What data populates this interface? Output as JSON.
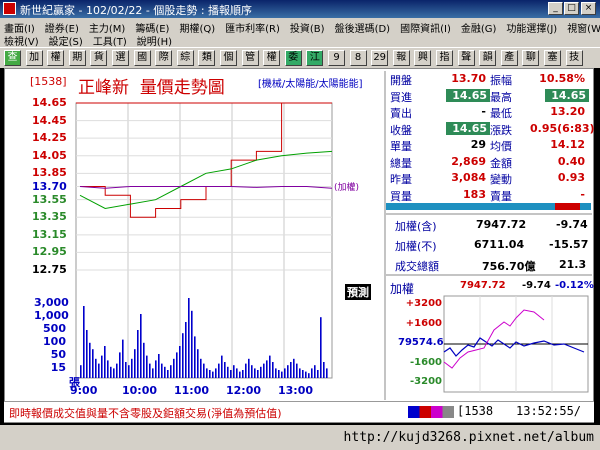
{
  "window": {
    "title": "新世紀贏家 - 102/02/22 - 個股走勢 : 播報順序",
    "min": "_",
    "restore": "□",
    "close": "×"
  },
  "menu": {
    "row1": [
      "畫面(I)",
      "證券(E)",
      "主力(M)",
      "籌碼(E)",
      "期權(Q)",
      "匯市利率(R)",
      "投資(B)",
      "盤後選碼(D)",
      "國際資訊(I)",
      "金融(G)",
      "功能選擇(J)",
      "視窗(W)"
    ],
    "row2": [
      "檢視(V)",
      "設定(S)",
      "工具(T)",
      "說明(H)"
    ]
  },
  "toolbar": [
    "查",
    "加",
    "權",
    "期",
    "貨",
    "選",
    "國",
    "際",
    "綜",
    "類",
    "個",
    "管",
    "權",
    "委",
    "江",
    "9",
    "8",
    "29",
    "報",
    "興",
    "指",
    "聲",
    "韻",
    "產",
    "聊",
    "塞",
    "技"
  ],
  "header": {
    "code": "[1538]",
    "name": "正峰新",
    "title": "量價走勢圖",
    "sub": "[機械/太陽能/太陽能能]"
  },
  "price_axis": [
    "14.65",
    "14.45",
    "14.25",
    "14.05",
    "13.85",
    "13.70",
    "13.55",
    "13.35",
    "13.15",
    "12.95",
    "12.75"
  ],
  "volume_axis": [
    "3,000",
    "1,000",
    "500",
    "100",
    "50",
    "15",
    "張"
  ],
  "time_axis": [
    "9:00",
    "10:00",
    "11:00",
    "12:00",
    "13:00"
  ],
  "index_tag": "(加權)",
  "forecast_tag": "預測",
  "quote": {
    "open_lbl": "開盤",
    "open": "13.70",
    "amp_lbl": "振幅",
    "amp": "10.58%",
    "buy_lbl": "買進",
    "buy": "14.65",
    "high_lbl": "最高",
    "high": "14.65",
    "sell_lbl": "賣出",
    "sell": "-",
    "low_lbl": "最低",
    "low": "13.20",
    "close_lbl": "收盤",
    "close": "14.65",
    "chg_lbl": "漲跌",
    "chg": "0.95(6:83)",
    "unit_lbl": "單量",
    "unit": "29",
    "avg_lbl": "均價",
    "avg": "14.12",
    "tvol_lbl": "總量",
    "tvol": "2,869",
    "amt_lbl": "金額",
    "amt": "0.40",
    "yvol_lbl": "昨量",
    "yvol": "3,084",
    "var_lbl": "變動",
    "var": "0.93",
    "bvol_lbl": "買量",
    "bvol": "183",
    "svol_lbl": "賣量",
    "svol": "-"
  },
  "index_box": {
    "r1_lbl": "加權(含)",
    "r1_val": "7947.72",
    "r1_chg": "-9.74",
    "r2_lbl": "加權(不)",
    "r2_val": "6711.04",
    "r2_chg": "-15.57",
    "r3_lbl": "成交總額",
    "r3_val": "756.70億",
    "r3_chg": "21.3"
  },
  "mini_chart": {
    "title": "加權",
    "value": "7947.72",
    "chg": "-9.74",
    "pct": "-0.12%",
    "axis": [
      "+3200",
      "+1600",
      "79574.6",
      "-1600",
      "-3200"
    ]
  },
  "bottom": {
    "note": "即時報價成交值與量不含零股及鉅額交易(淨值為預估值)",
    "code": "[1538",
    "time": "13:52:55/"
  },
  "watermark": "http://kujd3268.pixnet.net/album",
  "chart_data": {
    "type": "line",
    "x": [
      "9:00",
      "10:00",
      "11:00",
      "12:00",
      "13:00"
    ],
    "series": [
      {
        "values": [
          13.7,
          13.6,
          13.35,
          13.45,
          13.55,
          13.7,
          14.0,
          14.1,
          14.65,
          14.65,
          14.65
        ]
      },
      {
        "values": [
          13.6,
          13.45,
          13.5,
          13.55,
          13.7,
          13.85,
          13.9,
          14.0,
          14.05,
          14.08,
          14.1
        ]
      },
      {
        "values": [
          13.7,
          13.68,
          13.7,
          13.7,
          13.7,
          13.7,
          13.7,
          13.69,
          13.7,
          13.7,
          13.68
        ]
      }
    ],
    "ylim": [
      12.75,
      14.65
    ]
  },
  "colors": {
    "price": "#cc0000",
    "avg": "#00a000",
    "index": "#8000a0",
    "volume": "#0000cc"
  }
}
